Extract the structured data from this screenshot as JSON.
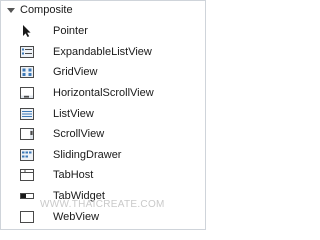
{
  "palette": {
    "header": {
      "title": "Composite",
      "expand_icon": "triangle-down-icon"
    },
    "items": [
      {
        "label": "Pointer",
        "icon": "cursor-arrow-icon"
      },
      {
        "label": "ExpandableListView",
        "icon": "expandable-list-icon"
      },
      {
        "label": "GridView",
        "icon": "grid-icon"
      },
      {
        "label": "HorizontalScrollView",
        "icon": "horizontal-scroll-icon"
      },
      {
        "label": "ListView",
        "icon": "list-icon"
      },
      {
        "label": "ScrollView",
        "icon": "vertical-scroll-icon"
      },
      {
        "label": "SlidingDrawer",
        "icon": "sliding-drawer-icon"
      },
      {
        "label": "TabHost",
        "icon": "tabhost-icon"
      },
      {
        "label": "TabWidget",
        "icon": "tabwidget-icon"
      },
      {
        "label": "WebView",
        "icon": "webview-icon"
      }
    ]
  },
  "watermark": "WWW.THAICREATE.COM",
  "colors": {
    "icon_stroke": "#4a4a4a",
    "icon_fill": "#eef2f7",
    "icon_accent": "#3d7ab8",
    "border": "#cfd4da"
  }
}
